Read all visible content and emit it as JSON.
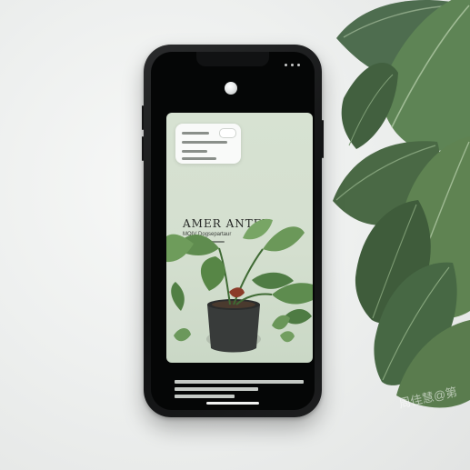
{
  "product": {
    "title": "AMER ANTET",
    "subtitle": "MOIV Dogsepartaur"
  },
  "watermark": "周佳慧@第",
  "icons": {
    "camera": "circle-camera-icon",
    "status": "signal-dots-icon",
    "plant": "potted-plant-image",
    "leaves": "background-leaves"
  },
  "colors": {
    "background": "#eceeed",
    "phone_body": "#121314",
    "card": "#d7e2d2",
    "leaf_dark": "#4d6b50",
    "leaf_light": "#6f9563",
    "pot": "#383b3a"
  }
}
